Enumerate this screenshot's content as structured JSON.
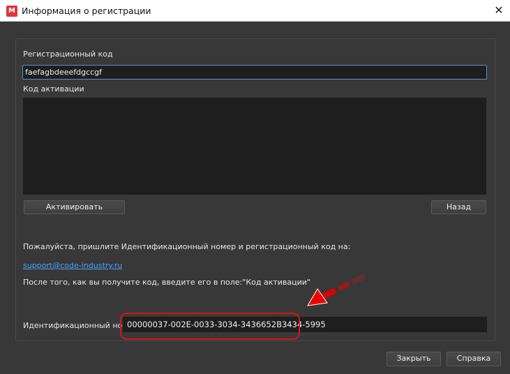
{
  "window": {
    "title": "Информация о регистрации",
    "logo_text": "M",
    "close": "✕"
  },
  "form": {
    "reg_code_label": "Регистрационный код",
    "reg_code_value": "faefagbdeeefdgccgf",
    "activation_label": "Код активации",
    "activation_value": "",
    "activate_button": "Активировать",
    "back_button": "Назад",
    "instructions": "Пожалуйста, пришлите Идентификационный номер и регистрационный код на:",
    "email": "support@code-industry.ru",
    "after_text": "После того, как вы получите код, введите его в поле:\"Код активации\"",
    "id_label": "Идентификационный номер",
    "id_value": "00000037-002E-0033-3034-3436652B3434-5995"
  },
  "footer": {
    "close_button": "Закрыть",
    "help_button": "Справка"
  },
  "colors": {
    "highlight": "#d8141c",
    "accent": "#5a8ed6",
    "link": "#4aa3ff"
  }
}
